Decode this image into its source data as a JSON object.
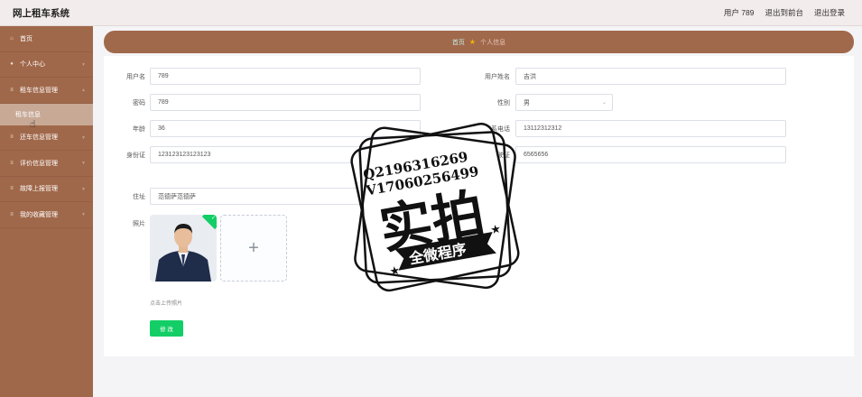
{
  "app": {
    "title": "网上租车系统"
  },
  "top_nav": {
    "user": "用户 789",
    "back_front": "退出到前台",
    "logout": "退出登录"
  },
  "sidebar": {
    "items": [
      {
        "label": "首页",
        "icon": "home-icon"
      },
      {
        "label": "个人中心",
        "icon": "user-icon"
      },
      {
        "label": "租车信息管理",
        "icon": "list-icon"
      },
      {
        "label": "还车信息管理",
        "icon": "list-icon"
      },
      {
        "label": "评价信息管理",
        "icon": "list-icon"
      },
      {
        "label": "故障上报管理",
        "icon": "list-icon"
      },
      {
        "label": "我的收藏管理",
        "icon": "list-icon"
      }
    ],
    "sub_active": "租车信息"
  },
  "breadcrumb": {
    "home": "首页",
    "current": "个人信息"
  },
  "form": {
    "username_label": "用户名",
    "username": "789",
    "realname_label": "用户姓名",
    "realname": "吉洪",
    "password_label": "密码",
    "password": "789",
    "gender_label": "性别",
    "gender": "男",
    "age_label": "年龄",
    "age": "36",
    "phone_label": "联系电话",
    "phone": "13112312312",
    "idcard_label": "身份证",
    "idcard": "123123123123123",
    "license_label": "驾驶证",
    "license": "6565656",
    "address_label": "住址",
    "address": "范德萨范德萨",
    "photo_label": "照片",
    "upload_tip": "点击上传照片",
    "submit": "修 改"
  },
  "watermark": {
    "line1": "Q2196316269",
    "line2": "V17060256499",
    "main": "实拍",
    "ribbon": "全微程序"
  },
  "colors": {
    "sidebar": "#a0684a",
    "accent": "#13ce66",
    "crumb": "#a1694c"
  }
}
